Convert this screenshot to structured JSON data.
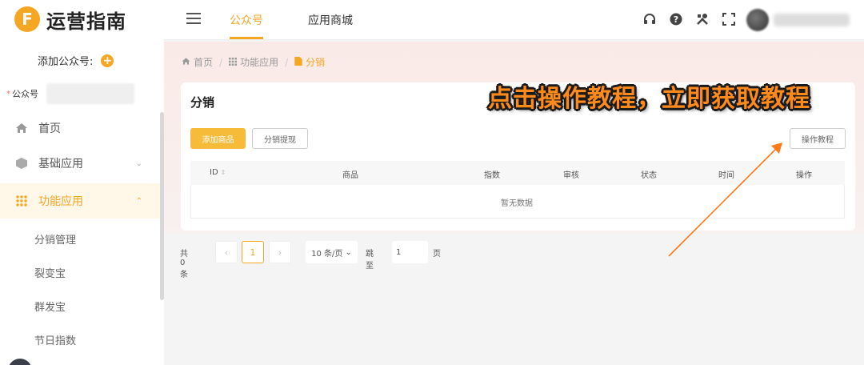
{
  "brand": {
    "logo_letter": "F",
    "name": "运营指南"
  },
  "sidebar": {
    "add_account_label": "添加公众号:",
    "account_label": "公众号",
    "menu": [
      {
        "label": "首页",
        "icon": "home-icon"
      },
      {
        "label": "基础应用",
        "icon": "cube-icon"
      },
      {
        "label": "功能应用",
        "icon": "grid-icon"
      }
    ],
    "sub_items": [
      "分销管理",
      "裂变宝",
      "群发宝",
      "节日指数"
    ]
  },
  "header": {
    "tabs": [
      "公众号",
      "应用商城"
    ],
    "active_tab": "公众号",
    "icons": [
      "headset-icon",
      "help-icon",
      "tools-icon",
      "fullscreen-icon"
    ]
  },
  "breadcrumb": [
    "首页",
    "功能应用",
    "分销"
  ],
  "page": {
    "title": "分销",
    "add_button": "添加商品",
    "withdraw_button": "分销提现",
    "tutorial_button": "操作教程",
    "columns": [
      "ID",
      "商品",
      "指数",
      "审核",
      "状态",
      "时间",
      "操作"
    ],
    "empty_text": "暂无数据"
  },
  "pagination": {
    "total_text": "共 0 条",
    "current_page": "1",
    "page_size": "10 条/页",
    "jump_label": "跳至",
    "jump_value": "1",
    "page_label": "页"
  },
  "overlay": {
    "promo_text": "点击操作教程，立即获取教程",
    "promo_color": "#ff8a1c"
  },
  "colors": {
    "accent": "#f5a623",
    "button_primary": "#f7bb3a",
    "background": "#f4f4f4"
  }
}
